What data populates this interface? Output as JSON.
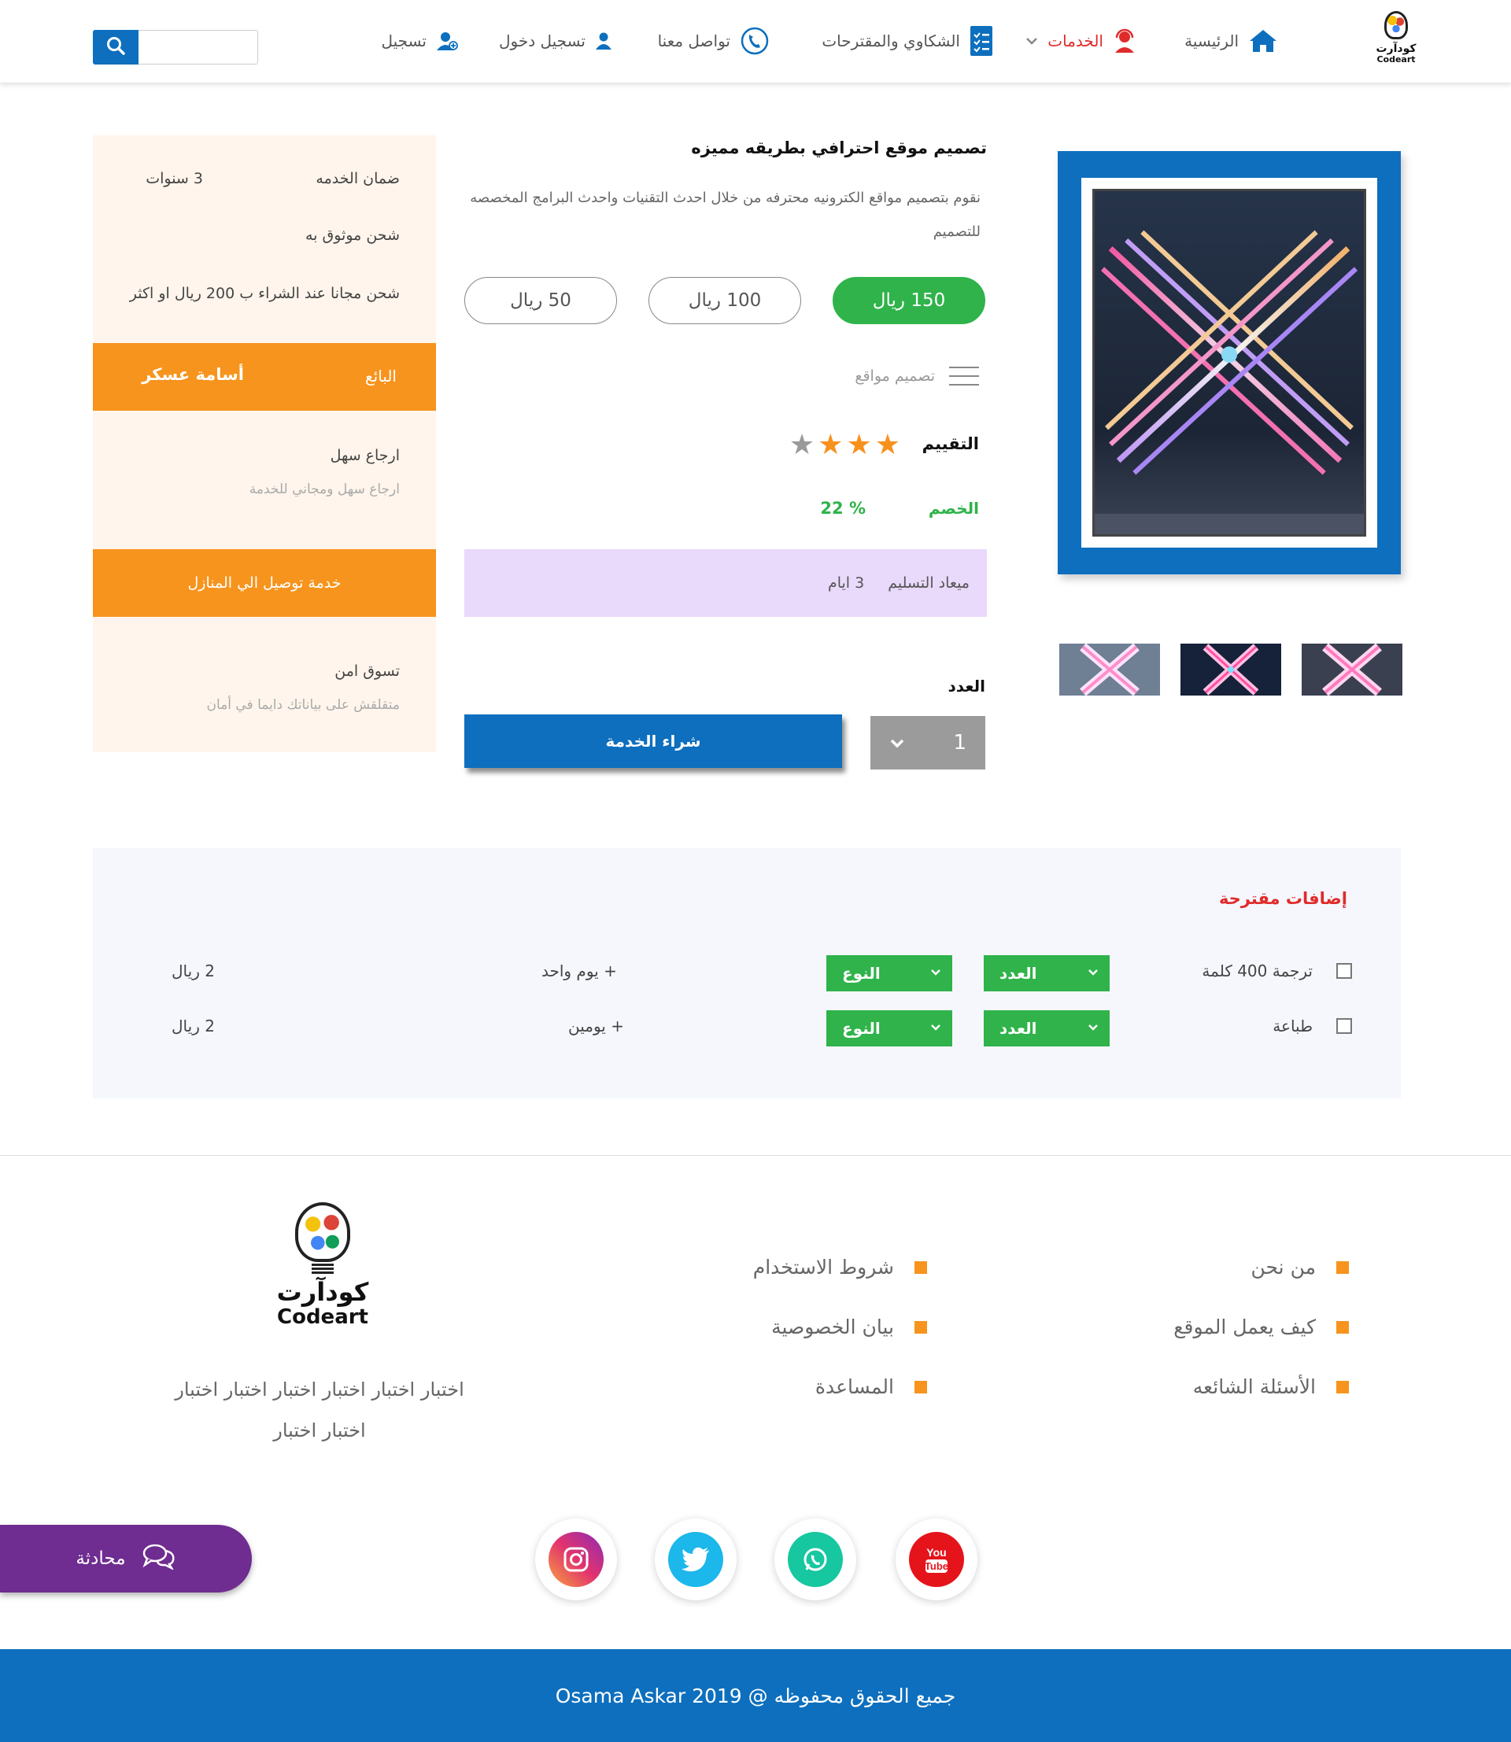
{
  "header": {
    "logo_ar": "كودآرت",
    "logo_en": "Codeart",
    "nav": [
      {
        "label": "الرئيسية",
        "icon": "home-icon"
      },
      {
        "label": "الخدمات",
        "icon": "support-agent-icon",
        "active": true
      },
      {
        "label": "الشكاوي والمقترحات",
        "icon": "clipboard-list-icon"
      },
      {
        "label": "تواصل معنا",
        "icon": "phone-icon"
      },
      {
        "label": "تسجيل دخول",
        "icon": "user-icon"
      },
      {
        "label": "تسجيل",
        "icon": "user-add-icon"
      }
    ],
    "search": {
      "placeholder": "",
      "icon": "search-icon"
    }
  },
  "product": {
    "title": "تصميم موقع احترافي  بطريقه مميزه",
    "description": "نقوم بتصميم مواقع الكترونيه محترفه من خلال احدث التقنيات واحدث البرامج المخصصه للتصميم",
    "prices": [
      "150  ريال",
      "100 ريال",
      "50 ريال"
    ],
    "selected_price_index": 0,
    "category": "تصميم مواقع",
    "rating_label": "التقييم",
    "rating": 3,
    "rating_max": 4,
    "discount_label": "الخصم",
    "discount_value": "22 %",
    "delivery_label": "ميعاد التسليم",
    "delivery_value": "3   ايام",
    "qty_label": "العدد",
    "qty_value": "1",
    "buy_label": "شراء الخدمة"
  },
  "info": {
    "warranty_label": "ضمان الخدمه",
    "warranty_value": "3   سنوات",
    "trusted_shipping": "شحن موثوق به",
    "free_shipping": "شحن مجانا عند الشراء ب 200 ريال او اكثر",
    "seller_label": "البائع",
    "seller_name": "أسامة عسكر",
    "return_title": "ارجاع سهل",
    "return_sub": "ارجاع سهل ومجاني للخدمة",
    "home_delivery": "خدمة توصيل الي المنازل",
    "secure_title": "تسوق امن",
    "secure_sub": "متقلقش على بياناتك دايما في أمان"
  },
  "addons": {
    "title": "إضافات مقترحة",
    "rows": [
      {
        "name": "ترجمة 400 كلمة",
        "qty_label": "العدد",
        "type_label": "النوع",
        "option": "+   يوم   واحد",
        "price": "2   ريال"
      },
      {
        "name": "طباعة",
        "qty_label": "العدد",
        "type_label": "النوع",
        "option": "+   يومين",
        "price": "2   ريال"
      }
    ]
  },
  "footer": {
    "links_col1": [
      "من نحن",
      "كيف يعمل الموقع",
      "الأسئلة الشائعه"
    ],
    "links_col2": [
      "شروط الاستخدام",
      "بيان الخصوصية",
      "المساعدة"
    ],
    "logo_ar": "كودآرت",
    "logo_en": "Codeart",
    "description": "اختبار اختبار اختبار اختبار اختبار اختبار اختبار اختبار",
    "social": [
      "youtube-icon",
      "whatsapp-icon",
      "twitter-icon",
      "instagram-icon"
    ],
    "chat_label": "محادثة",
    "copyright": "جميع الحقوق محفوظه @  2019  Osama Askar"
  },
  "colors": {
    "primary": "#0d6fbe",
    "green": "#2fb34a",
    "orange": "#f7941d",
    "red": "#e02b2b",
    "purple": "#6f2c91"
  }
}
